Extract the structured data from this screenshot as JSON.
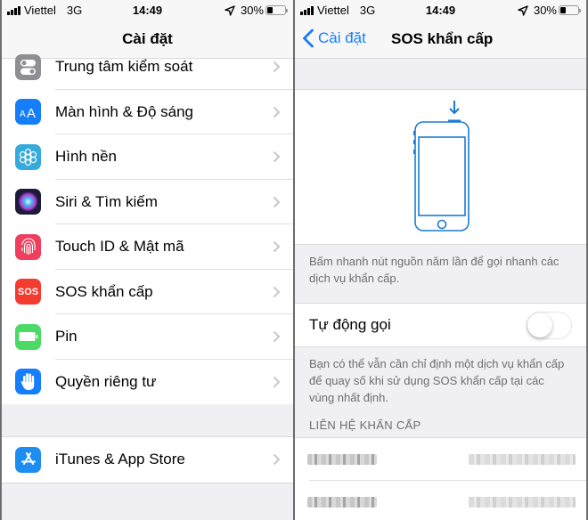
{
  "status_bar": {
    "carrier": "Viettel",
    "network": "3G",
    "time": "14:49",
    "battery_percent": "30%",
    "battery_level": 0.3,
    "icons": [
      "signal-icon",
      "location-icon",
      "battery-icon"
    ]
  },
  "left": {
    "nav_title": "Cài đặt",
    "group1": [
      {
        "label": "Trung tâm kiểm soát",
        "icon": "control-center-icon",
        "color": "#8e8e93"
      },
      {
        "label": "Màn hình & Độ sáng",
        "icon": "display-brightness-icon",
        "color": "#147efb"
      },
      {
        "label": "Hình nền",
        "icon": "wallpaper-icon",
        "color": "#36aadc"
      },
      {
        "label": "Siri & Tìm kiếm",
        "icon": "siri-icon",
        "color": "#1c1c3a"
      },
      {
        "label": "Touch ID & Mật mã",
        "icon": "fingerprint-icon",
        "color": "#f03e5e"
      },
      {
        "label": "SOS khẩn cấp",
        "icon": "sos-icon",
        "color": "#f43b30",
        "icon_text": "SOS"
      },
      {
        "label": "Pin",
        "icon": "battery-app-icon",
        "color": "#4cd964"
      },
      {
        "label": "Quyền riêng tư",
        "icon": "privacy-hand-icon",
        "color": "#147efb"
      }
    ],
    "group2": [
      {
        "label": "iTunes & App Store",
        "icon": "app-store-icon",
        "color": "#1d8df2"
      }
    ]
  },
  "right": {
    "back_label": "Cài đặt",
    "nav_title": "SOS khẩn cấp",
    "illustration_note": "Bấm nhanh nút nguồn năm lần để gọi nhanh các dịch vụ khẩn cấp.",
    "auto_call": {
      "label": "Tự động gọi",
      "enabled": false
    },
    "auto_call_note": "Bạn có thể vẫn cần chỉ định một dịch vụ khẩn cấp để quay số khi sử dụng SOS khẩn cấp tại các vùng nhất định.",
    "contacts_header": "LIÊN HỆ KHẨN CẤP",
    "contacts_note": "Contact names and numbers are pixelated/obscured",
    "accent": "#147efb"
  }
}
